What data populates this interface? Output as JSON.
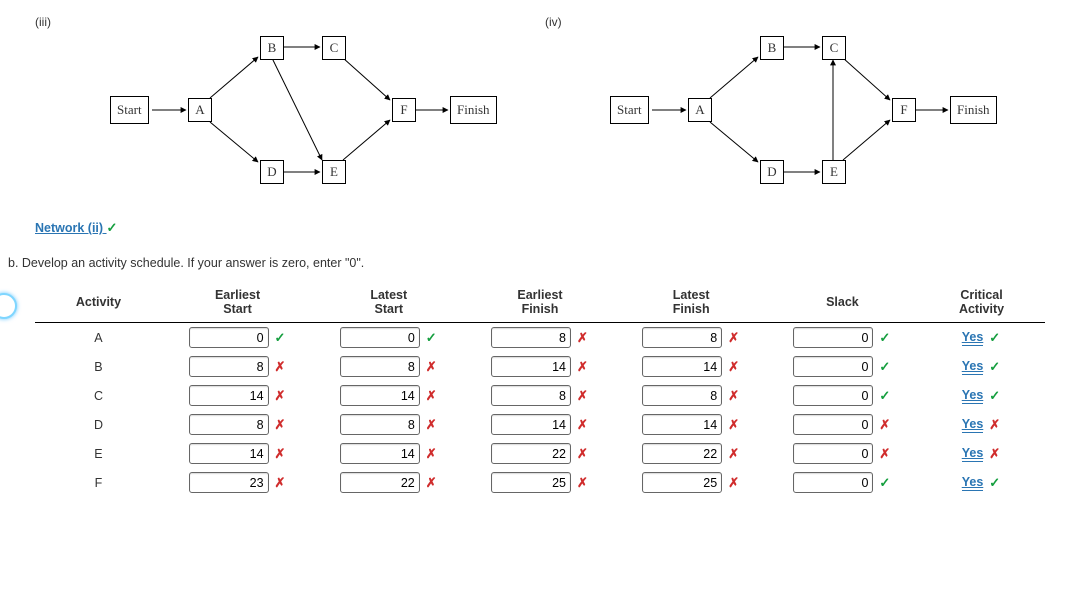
{
  "diagrams": {
    "left_label": "(iii)",
    "right_label": "(iv)",
    "nodes": {
      "start": "Start",
      "a": "A",
      "b": "B",
      "c": "C",
      "d": "D",
      "e": "E",
      "f": "F",
      "finish": "Finish"
    }
  },
  "answer_link": "Network (ii)",
  "question": "b. Develop an activity schedule. If your answer is zero, enter \"0\".",
  "headers": {
    "activity": "Activity",
    "es": "Earliest Start",
    "ls": "Latest Start",
    "ef": "Earliest Finish",
    "lf": "Latest Finish",
    "slack": "Slack",
    "crit": "Critical Activity"
  },
  "rows": [
    {
      "act": "A",
      "es": {
        "v": "0",
        "ok": true
      },
      "ls": {
        "v": "0",
        "ok": true
      },
      "ef": {
        "v": "8",
        "ok": false
      },
      "lf": {
        "v": "8",
        "ok": false
      },
      "slack": {
        "v": "0",
        "ok": true
      },
      "crit": {
        "v": "Yes",
        "ok": true
      }
    },
    {
      "act": "B",
      "es": {
        "v": "8",
        "ok": false
      },
      "ls": {
        "v": "8",
        "ok": false
      },
      "ef": {
        "v": "14",
        "ok": false
      },
      "lf": {
        "v": "14",
        "ok": false
      },
      "slack": {
        "v": "0",
        "ok": true
      },
      "crit": {
        "v": "Yes",
        "ok": true
      }
    },
    {
      "act": "C",
      "es": {
        "v": "14",
        "ok": false
      },
      "ls": {
        "v": "14",
        "ok": false
      },
      "ef": {
        "v": "8",
        "ok": false
      },
      "lf": {
        "v": "8",
        "ok": false
      },
      "slack": {
        "v": "0",
        "ok": true
      },
      "crit": {
        "v": "Yes",
        "ok": true
      }
    },
    {
      "act": "D",
      "es": {
        "v": "8",
        "ok": false
      },
      "ls": {
        "v": "8",
        "ok": false
      },
      "ef": {
        "v": "14",
        "ok": false
      },
      "lf": {
        "v": "14",
        "ok": false
      },
      "slack": {
        "v": "0",
        "ok": false
      },
      "crit": {
        "v": "Yes",
        "ok": false
      }
    },
    {
      "act": "E",
      "es": {
        "v": "14",
        "ok": false
      },
      "ls": {
        "v": "14",
        "ok": false
      },
      "ef": {
        "v": "22",
        "ok": false
      },
      "lf": {
        "v": "22",
        "ok": false
      },
      "slack": {
        "v": "0",
        "ok": false
      },
      "crit": {
        "v": "Yes",
        "ok": false
      }
    },
    {
      "act": "F",
      "es": {
        "v": "23",
        "ok": false
      },
      "ls": {
        "v": "22",
        "ok": false
      },
      "ef": {
        "v": "25",
        "ok": false
      },
      "lf": {
        "v": "25",
        "ok": false
      },
      "slack": {
        "v": "0",
        "ok": true
      },
      "crit": {
        "v": "Yes",
        "ok": true
      }
    }
  ]
}
